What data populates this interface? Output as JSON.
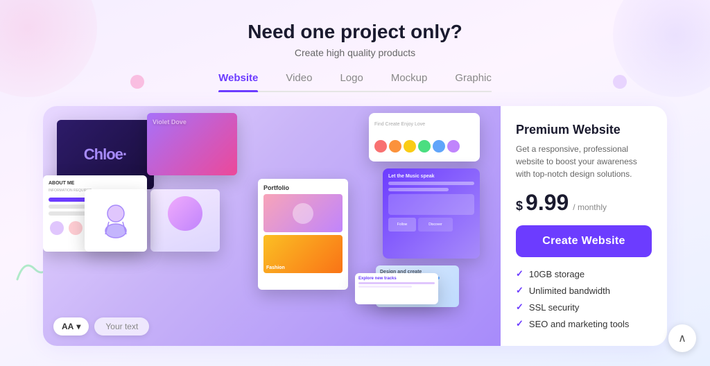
{
  "header": {
    "title": "Need one project only?",
    "subtitle": "Create high quality products"
  },
  "tabs": {
    "items": [
      {
        "id": "website",
        "label": "Website",
        "active": true
      },
      {
        "id": "video",
        "label": "Video",
        "active": false
      },
      {
        "id": "logo",
        "label": "Logo",
        "active": false
      },
      {
        "id": "mockup",
        "label": "Mockup",
        "active": false
      },
      {
        "id": "graphic",
        "label": "Graphic",
        "active": false
      }
    ]
  },
  "preview": {
    "font_selector_label": "AA",
    "font_selector_arrow": "▾",
    "text_placeholder": "Your text",
    "mockup_chloe_text": "Chloe·",
    "mockup_violet_label": "Violet Dove"
  },
  "pricing": {
    "title": "Premium Website",
    "description": "Get a responsive, professional website to boost your awareness with top-notch design solutions.",
    "price_symbol": "$",
    "price_value": "9.99",
    "price_period": "/ monthly",
    "cta_label": "Create Website",
    "features": [
      {
        "id": "storage",
        "label": "10GB storage"
      },
      {
        "id": "bandwidth",
        "label": "Unlimited bandwidth"
      },
      {
        "id": "ssl",
        "label": "SSL security"
      },
      {
        "id": "seo",
        "label": "SEO and marketing tools"
      }
    ]
  },
  "palette_colors": [
    "#f87171",
    "#fb923c",
    "#facc15",
    "#4ade80",
    "#60a5fa",
    "#c084fc"
  ],
  "scroll_top_label": "∧"
}
